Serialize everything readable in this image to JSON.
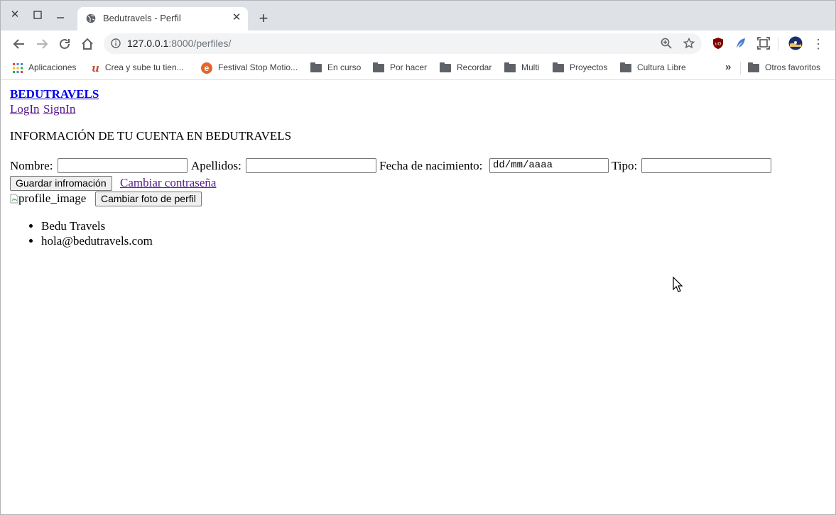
{
  "browser": {
    "tab_title": "Bedutravels - Perfil",
    "url_host": "127.0.0.1",
    "url_rest": ":8000/perfiles/"
  },
  "bookmarks": [
    {
      "label": "Aplicaciones",
      "icon": "apps-grid-icon"
    },
    {
      "label": "Crea y sube tu tien...",
      "icon": "u-logo-icon"
    },
    {
      "label": "Festival Stop Motio...",
      "icon": "e-logo-icon"
    },
    {
      "label": "En curso",
      "icon": "folder-icon"
    },
    {
      "label": "Por hacer",
      "icon": "folder-icon"
    },
    {
      "label": "Recordar",
      "icon": "folder-icon"
    },
    {
      "label": "Multi",
      "icon": "folder-icon"
    },
    {
      "label": "Proyectos",
      "icon": "folder-icon"
    },
    {
      "label": "Cultura Libre",
      "icon": "folder-icon"
    }
  ],
  "bookmarks_overflow": "»",
  "other_bookmarks": "Otros favoritos",
  "page": {
    "brand": "BEDUTRAVELS",
    "nav": {
      "login": "LogIn",
      "signin": "SignIn"
    },
    "heading": "INFORMACIÓN DE TU CUENTA EN BEDUTRAVELS",
    "form": {
      "nombre_label": "Nombre:",
      "nombre_value": "",
      "apellidos_label": "Apellidos:",
      "apellidos_value": "",
      "fecha_label": "Fecha de nacimiento:",
      "fecha_value": "dd/mm/aaaa",
      "tipo_label": "Tipo:",
      "tipo_value": "",
      "save_button": "Guardar infromación",
      "change_password": "Cambiar contraseña"
    },
    "profile_image_alt": "profile_image",
    "change_photo_button": "Cambiar foto de perfil",
    "info_list": [
      "Bedu Travels",
      "hola@bedutravels.com"
    ]
  }
}
